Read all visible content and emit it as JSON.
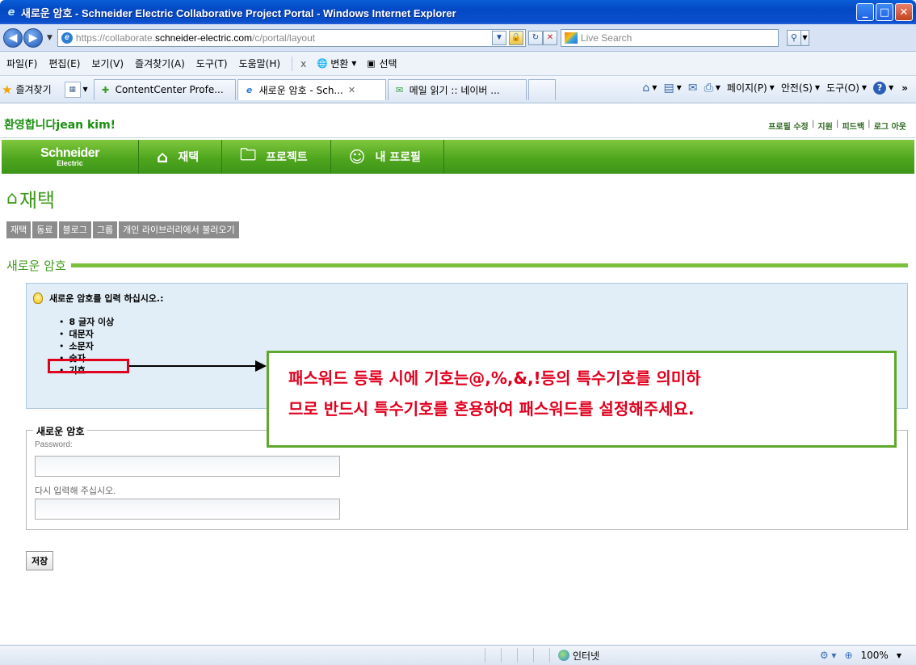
{
  "window": {
    "title": "새로운 암호 - Schneider Electric Collaborative Project Portal - Windows Internet Explorer",
    "minimize": "_",
    "maximize": "□",
    "close": "✕"
  },
  "address": {
    "url_prefix": "https://collaborate.",
    "url_host": "schneider-electric.com",
    "url_path": "/c/portal/layout",
    "search_placeholder": "Live Search"
  },
  "menu": {
    "items": [
      "파일(F)",
      "편집(E)",
      "보기(V)",
      "즐겨찾기(A)",
      "도구(T)",
      "도움말(H)"
    ],
    "close_x": "x",
    "translate_label": "변환",
    "select_label": "선택"
  },
  "favorites": {
    "label": "즐겨찾기",
    "tabs": [
      {
        "label": "ContentCenter Profe...",
        "active": false
      },
      {
        "label": "새로운 암호 - Sch...",
        "active": true
      },
      {
        "label": "메일 읽기 :: 네이버 ...",
        "active": false
      }
    ],
    "cmd": {
      "page": "페이지(P)",
      "safety": "안전(S)",
      "tools": "도구(O)"
    }
  },
  "portal": {
    "welcome": "환영합니다jean kim!",
    "links": [
      "프로필 수정",
      "지원",
      "피드백",
      "로그 아웃"
    ],
    "brand_top": "Schneider",
    "brand_bottom": "Electric",
    "nav": [
      "재택",
      "프로젝트",
      "내 프로필"
    ],
    "page_title": "재택",
    "subtabs": [
      "재택",
      "동료",
      "블로그",
      "그룹",
      "개인 라이브러리에서 불러오기"
    ],
    "section_title": "새로운 암호",
    "info_heading": "새로운 암호를 입력 하십시오.:",
    "rules": [
      "8 글자 이상",
      "대문자",
      "소문자",
      "숫자",
      "기호"
    ],
    "fieldset_legend": "새로운 암호",
    "password_label": "Password:",
    "confirm_label": "다시 입력해 주십시오.",
    "save_label": "저장"
  },
  "annotation": {
    "line1": "패스워드 등록 시에 기호는@,%,&,!등의 특수기호를 의미하",
    "line2": "므로 반드시 특수기호를 혼용하여 패스워드를 설정해주세요."
  },
  "status": {
    "zone": "인터넷",
    "zoom": "100%"
  },
  "colors": {
    "portal_green": "#4fa61d",
    "annotation_red": "#e0001e"
  }
}
